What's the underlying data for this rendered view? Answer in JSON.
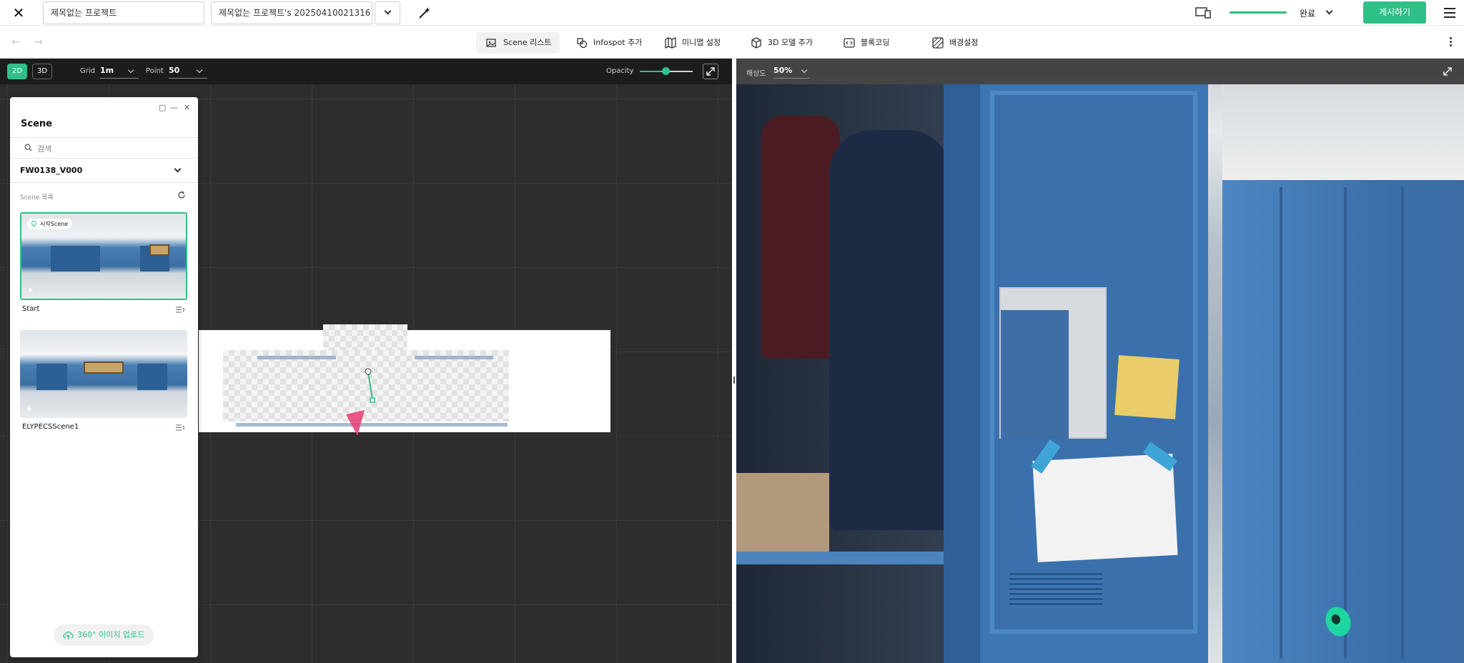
{
  "topbar": {
    "project_title": "제목없는 프로젝트",
    "project_file": "제목없는 프로젝트's 20250410021316",
    "status_label": "완료",
    "progress": 1.0,
    "publish_label": "게시하기",
    "accent_color": "#2fc088"
  },
  "toolbar": {
    "items": [
      {
        "label": "Scene 리스트",
        "icon": "image-list-icon",
        "active": true
      },
      {
        "label": "Infospot 추가",
        "icon": "shapes-icon",
        "active": false
      },
      {
        "label": "미니맵 설정",
        "icon": "map-icon",
        "active": false
      },
      {
        "label": "3D 모델 추가",
        "icon": "cube-icon",
        "active": false
      },
      {
        "label": "블록코딩",
        "icon": "code-block-icon",
        "active": false
      },
      {
        "label": "배경설정",
        "icon": "pattern-icon",
        "active": false
      }
    ]
  },
  "editor": {
    "mode_2d": "2D",
    "mode_3d": "3D",
    "grid_label": "Grid",
    "grid_value": "1m",
    "point_label": "Point",
    "point_value": "50",
    "opacity_label": "Opacity",
    "opacity_value": 0.4
  },
  "scene_panel": {
    "title": "Scene",
    "search_placeholder": "검색",
    "project_name": "FW0138_V000",
    "section_label": "Scene 목록",
    "scenes": [
      {
        "name": "Start",
        "badge": "시작Scene",
        "active": true
      },
      {
        "name": "ELYPECSScene1",
        "active": false
      }
    ],
    "upload_label": "360° 이미지 업로드"
  },
  "viewer": {
    "resolution_label": "해상도",
    "resolution_value": "50%"
  }
}
